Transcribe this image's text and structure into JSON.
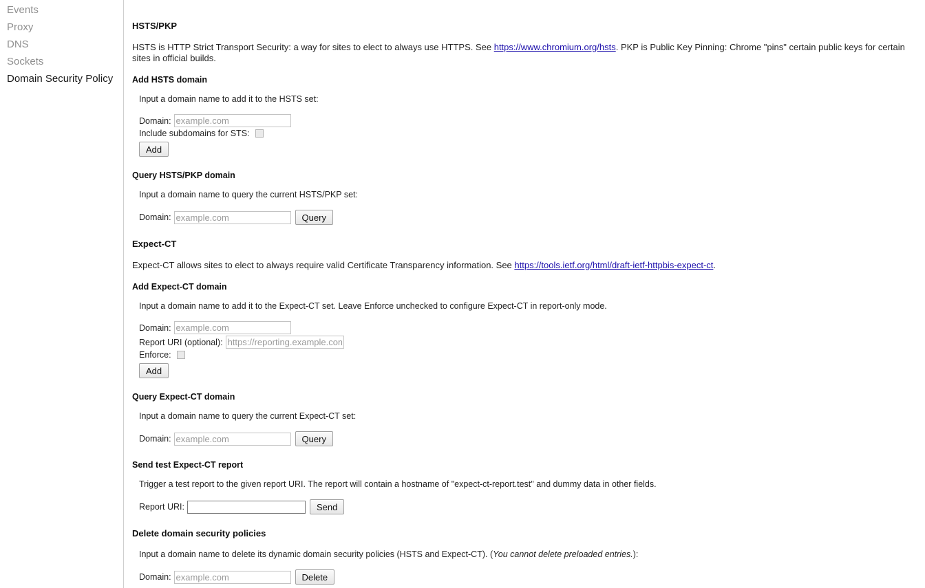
{
  "sidebar": {
    "items": [
      {
        "label": "Events",
        "active": false
      },
      {
        "label": "Proxy",
        "active": false
      },
      {
        "label": "DNS",
        "active": false
      },
      {
        "label": "Sockets",
        "active": false
      },
      {
        "label": "Domain Security Policy",
        "active": true
      }
    ]
  },
  "hsts": {
    "title": "HSTS/PKP",
    "desc_before_link": "HSTS is HTTP Strict Transport Security: a way for sites to elect to always use HTTPS. See ",
    "link_text": "https://www.chromium.org/hsts",
    "desc_after_link": ". PKP is Public Key Pinning: Chrome \"pins\" certain public keys for certain sites in official builds.",
    "add": {
      "heading": "Add HSTS domain",
      "hint": "Input a domain name to add it to the HSTS set:",
      "domain_label": "Domain:",
      "domain_placeholder": "example.com",
      "domain_value": "",
      "subdomains_label": "Include subdomains for STS:",
      "subdomains_checked": false,
      "add_button": "Add"
    },
    "query": {
      "heading": "Query HSTS/PKP domain",
      "hint": "Input a domain name to query the current HSTS/PKP set:",
      "domain_label": "Domain:",
      "domain_placeholder": "example.com",
      "domain_value": "",
      "query_button": "Query"
    }
  },
  "expect_ct": {
    "title": "Expect-CT",
    "desc_before_link": "Expect-CT allows sites to elect to always require valid Certificate Transparency information. See ",
    "link_text": "https://tools.ietf.org/html/draft-ietf-httpbis-expect-ct",
    "desc_after_link": ".",
    "add": {
      "heading": "Add Expect-CT domain",
      "hint": "Input a domain name to add it to the Expect-CT set. Leave Enforce unchecked to configure Expect-CT in report-only mode.",
      "domain_label": "Domain:",
      "domain_placeholder": "example.com",
      "domain_value": "",
      "report_uri_label": "Report URI (optional):",
      "report_uri_placeholder": "https://reporting.example.com/",
      "report_uri_value": "",
      "enforce_label": "Enforce:",
      "enforce_checked": false,
      "add_button": "Add"
    },
    "query": {
      "heading": "Query Expect-CT domain",
      "hint": "Input a domain name to query the current Expect-CT set:",
      "domain_label": "Domain:",
      "domain_placeholder": "example.com",
      "domain_value": "",
      "query_button": "Query"
    },
    "send_report": {
      "heading": "Send test Expect-CT report",
      "hint": "Trigger a test report to the given report URI. The report will contain a hostname of \"expect-ct-report.test\" and dummy data in other fields.",
      "report_uri_label": "Report URI:",
      "report_uri_placeholder": "",
      "report_uri_value": "",
      "send_button": "Send"
    }
  },
  "delete": {
    "heading": "Delete domain security policies",
    "hint_before_italic": "Input a domain name to delete its dynamic domain security policies (HSTS and Expect-CT). (",
    "hint_italic": "You cannot delete preloaded entries.",
    "hint_after_italic": "):",
    "domain_label": "Domain:",
    "domain_placeholder": "example.com",
    "domain_value": "",
    "delete_button": "Delete"
  },
  "colors": {
    "link": "#1a0dab",
    "nav_inactive": "#909090",
    "nav_active": "#1a1a1a",
    "text": "#222222"
  }
}
